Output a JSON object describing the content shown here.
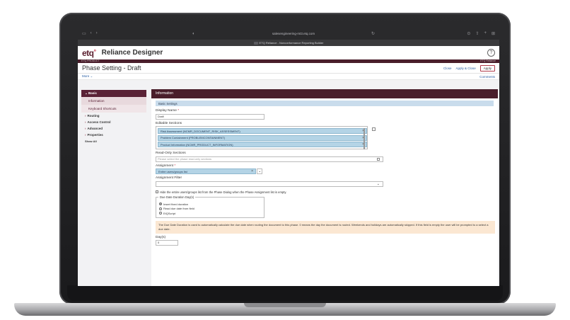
{
  "browser": {
    "url": "salesengineering-mt3.etq.com",
    "tab_title": "ETQ Reliance - Nonconformance Reporting Builder"
  },
  "app": {
    "logo": "etq",
    "title": "Reliance Designer",
    "product_left": "ETQ PRODUCT",
    "product_right": "ETQ Reliance"
  },
  "page": {
    "title": "Phase Setting - Draft",
    "close": "Close",
    "apply_close": "Apply & Close",
    "apply": "Apply",
    "more": "More ⌄",
    "comments": "Comments"
  },
  "sidebar": {
    "basic": "Basic",
    "information": "Information",
    "keyboard_shortcuts": "Keyboard Shortcuts",
    "routing": "Routing",
    "access_control": "Access Control",
    "advanced": "Advanced",
    "properties": "Properties",
    "show_all": "Show All"
  },
  "panel": {
    "header": "Information",
    "basic_settings": "Basic Settings",
    "display_name_label": "Display Name",
    "display_name_value": "Draft",
    "editable_sections_label": "Editable Sections",
    "editable_sections": [
      "Risk Assessment (NCMR_DOCUMENT_RISK_ASSESSMENT)",
      "Problem Containment (PROBLEMCONTAINMENT)",
      "Product Information (NCMR_PRODUCT_INFORMATION)"
    ],
    "readonly_label": "Read-Only Sections",
    "readonly_placeholder": "Please select the phase read-only sections",
    "assignment_label": "Assignment",
    "assignment_value": "Entire users/groups list",
    "assignment_filter_label": "Assignment Filter",
    "hide_checkbox_label": "Hide the entire users/groups list from the Phase Dialog when the Phase Assignment list is empty.",
    "due_date_legend": "Due Date Duration Day(s)",
    "due_options": [
      "Insert fixed duration",
      "Read due date from field",
      "EtQScript"
    ],
    "note": "The Due Date Duration is used to automatically calculate the due date when routing the document to this phase. 0 means the day the document is routed. Weekends and holidays are automatically skipped. If this field is empty the user will be prompted to a select a due date.",
    "days_label": "Day(s)",
    "days_value": "0"
  }
}
